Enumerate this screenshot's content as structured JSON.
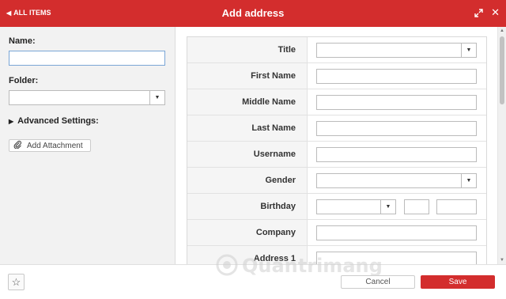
{
  "header": {
    "back_label": "ALL ITEMS",
    "title": "Add address"
  },
  "left": {
    "name_label": "Name:",
    "name_value": "",
    "folder_label": "Folder:",
    "folder_value": "",
    "advanced_label": "Advanced Settings:",
    "attach_label": "Add Attachment"
  },
  "form": {
    "rows": [
      {
        "label": "Title",
        "type": "select",
        "value": ""
      },
      {
        "label": "First Name",
        "type": "text",
        "value": ""
      },
      {
        "label": "Middle Name",
        "type": "text",
        "value": ""
      },
      {
        "label": "Last Name",
        "type": "text",
        "value": ""
      },
      {
        "label": "Username",
        "type": "text",
        "value": ""
      },
      {
        "label": "Gender",
        "type": "select",
        "value": ""
      },
      {
        "label": "Birthday",
        "type": "date",
        "value": ""
      },
      {
        "label": "Company",
        "type": "text",
        "value": ""
      },
      {
        "label": "Address 1",
        "type": "text",
        "value": ""
      }
    ]
  },
  "footer": {
    "cancel_label": "Cancel",
    "save_label": "Save"
  },
  "watermark": {
    "text": "Quantrimang"
  },
  "colors": {
    "brand": "#d32d2d",
    "focus_border": "#7aa6d6"
  },
  "icons": {
    "back": "chevron-left-icon",
    "expand": "expand-icon",
    "close": "close-icon",
    "advanced": "triangle-right-icon",
    "attach": "paperclip-icon",
    "favorite": "star-icon"
  }
}
